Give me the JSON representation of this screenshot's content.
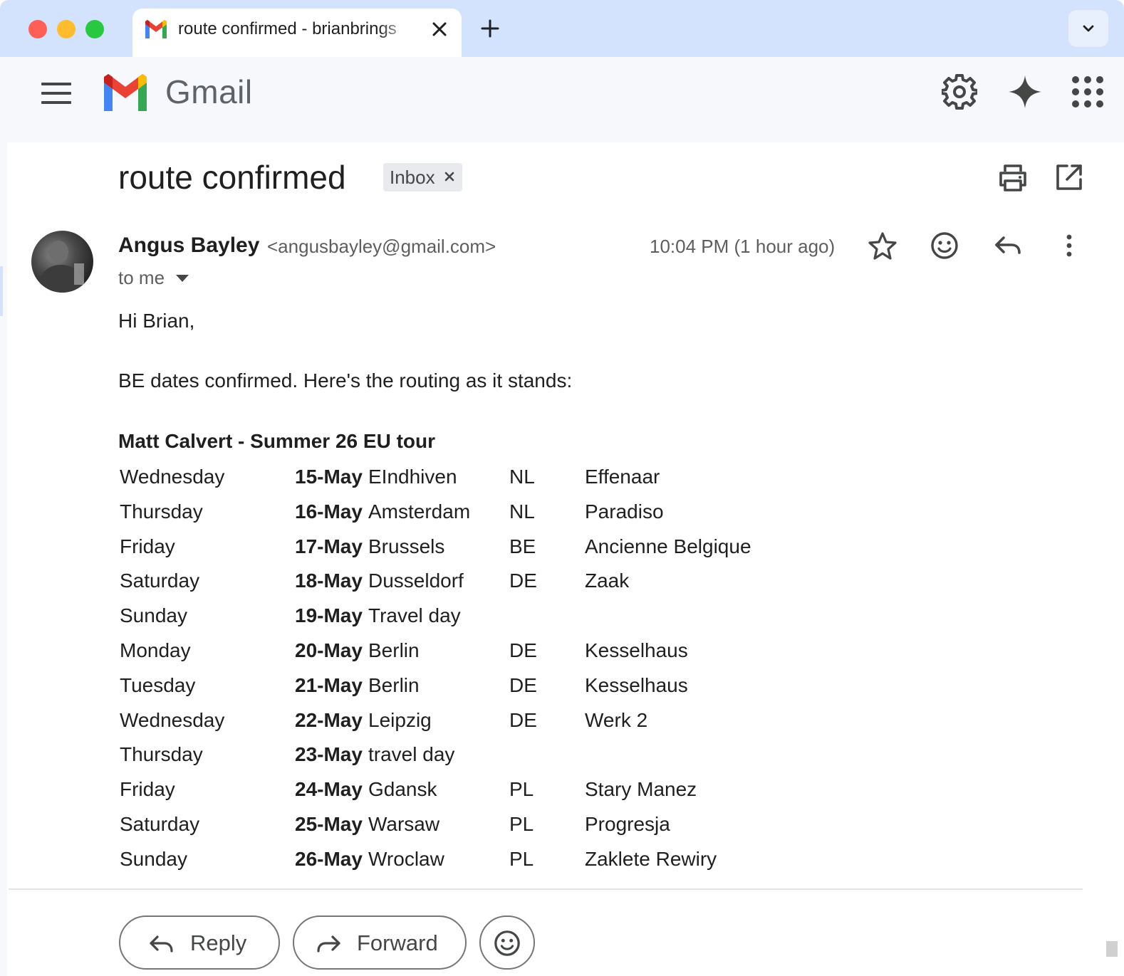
{
  "browser": {
    "tab_title": "route confirmed - brianbrings",
    "icons": [
      "gmail-favicon",
      "close-icon",
      "plus-icon",
      "chevron-down-icon"
    ]
  },
  "gmail": {
    "brand": "Gmail",
    "icons": [
      "menu-icon",
      "settings-icon",
      "gemini-icon",
      "apps-icon"
    ]
  },
  "email": {
    "subject": "route confirmed",
    "label": "Inbox",
    "sender_name": "Angus Bayley",
    "sender_email": "<angusbayley@gmail.com>",
    "recipients": "to me",
    "timestamp": "10:04 PM (1 hour ago)",
    "greeting": "Hi Brian,",
    "intro": "BE dates confirmed. Here's the routing as it stands:",
    "tour_title": "Matt Calvert - Summer 26 EU tour",
    "routing": [
      {
        "day": "Wednesday",
        "date": "15-May",
        "city": "EIndhiven",
        "country": "NL",
        "venue": "Effenaar"
      },
      {
        "day": "Thursday",
        "date": "16-May",
        "city": "Amsterdam",
        "country": "NL",
        "venue": "Paradiso"
      },
      {
        "day": "Friday",
        "date": "17-May",
        "city": "Brussels",
        "country": "BE",
        "venue": "Ancienne Belgique"
      },
      {
        "day": "Saturday",
        "date": "18-May",
        "city": "Dusseldorf",
        "country": "DE",
        "venue": "Zaak"
      },
      {
        "day": "Sunday",
        "date": "19-May",
        "city": "Travel day",
        "country": "",
        "venue": ""
      },
      {
        "day": "Monday",
        "date": "20-May",
        "city": "Berlin",
        "country": "DE",
        "venue": "Kesselhaus"
      },
      {
        "day": "Tuesday",
        "date": "21-May",
        "city": "Berlin",
        "country": "DE",
        "venue": "Kesselhaus"
      },
      {
        "day": "Wednesday",
        "date": "22-May",
        "city": "Leipzig",
        "country": "DE",
        "venue": "Werk 2"
      },
      {
        "day": "Thursday",
        "date": "23-May",
        "city": "travel day",
        "country": "",
        "venue": ""
      },
      {
        "day": "Friday",
        "date": "24-May",
        "city": "Gdansk",
        "country": "PL",
        "venue": "Stary Manez"
      },
      {
        "day": "Saturday",
        "date": "25-May",
        "city": "Warsaw",
        "country": "PL",
        "venue": "Progresja"
      },
      {
        "day": "Sunday",
        "date": "26-May",
        "city": "Wroclaw",
        "country": "PL",
        "venue": "Zaklete Rewiry"
      }
    ]
  },
  "actions": {
    "reply_label": "Reply",
    "forward_label": "Forward"
  },
  "colors": {
    "chrome_bar": "#d3e3fd",
    "gmail_background": "#f6f8fc",
    "gmail_red": "#ea4335",
    "gmail_blue": "#4285f4",
    "gmail_green": "#34a853",
    "gmail_yellow": "#fbbc04",
    "label_chip": "#e8eaed"
  }
}
